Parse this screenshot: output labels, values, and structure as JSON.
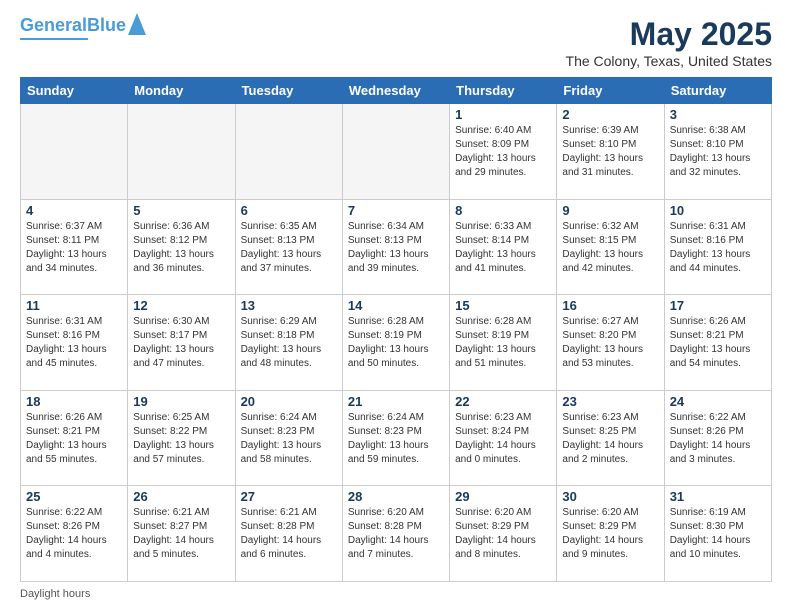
{
  "logo": {
    "line1": "General",
    "line2": "Blue"
  },
  "title": "May 2025",
  "subtitle": "The Colony, Texas, United States",
  "days_header": [
    "Sunday",
    "Monday",
    "Tuesday",
    "Wednesday",
    "Thursday",
    "Friday",
    "Saturday"
  ],
  "weeks": [
    [
      {
        "num": "",
        "info": ""
      },
      {
        "num": "",
        "info": ""
      },
      {
        "num": "",
        "info": ""
      },
      {
        "num": "",
        "info": ""
      },
      {
        "num": "1",
        "info": "Sunrise: 6:40 AM\nSunset: 8:09 PM\nDaylight: 13 hours and 29 minutes."
      },
      {
        "num": "2",
        "info": "Sunrise: 6:39 AM\nSunset: 8:10 PM\nDaylight: 13 hours and 31 minutes."
      },
      {
        "num": "3",
        "info": "Sunrise: 6:38 AM\nSunset: 8:10 PM\nDaylight: 13 hours and 32 minutes."
      }
    ],
    [
      {
        "num": "4",
        "info": "Sunrise: 6:37 AM\nSunset: 8:11 PM\nDaylight: 13 hours and 34 minutes."
      },
      {
        "num": "5",
        "info": "Sunrise: 6:36 AM\nSunset: 8:12 PM\nDaylight: 13 hours and 36 minutes."
      },
      {
        "num": "6",
        "info": "Sunrise: 6:35 AM\nSunset: 8:13 PM\nDaylight: 13 hours and 37 minutes."
      },
      {
        "num": "7",
        "info": "Sunrise: 6:34 AM\nSunset: 8:13 PM\nDaylight: 13 hours and 39 minutes."
      },
      {
        "num": "8",
        "info": "Sunrise: 6:33 AM\nSunset: 8:14 PM\nDaylight: 13 hours and 41 minutes."
      },
      {
        "num": "9",
        "info": "Sunrise: 6:32 AM\nSunset: 8:15 PM\nDaylight: 13 hours and 42 minutes."
      },
      {
        "num": "10",
        "info": "Sunrise: 6:31 AM\nSunset: 8:16 PM\nDaylight: 13 hours and 44 minutes."
      }
    ],
    [
      {
        "num": "11",
        "info": "Sunrise: 6:31 AM\nSunset: 8:16 PM\nDaylight: 13 hours and 45 minutes."
      },
      {
        "num": "12",
        "info": "Sunrise: 6:30 AM\nSunset: 8:17 PM\nDaylight: 13 hours and 47 minutes."
      },
      {
        "num": "13",
        "info": "Sunrise: 6:29 AM\nSunset: 8:18 PM\nDaylight: 13 hours and 48 minutes."
      },
      {
        "num": "14",
        "info": "Sunrise: 6:28 AM\nSunset: 8:19 PM\nDaylight: 13 hours and 50 minutes."
      },
      {
        "num": "15",
        "info": "Sunrise: 6:28 AM\nSunset: 8:19 PM\nDaylight: 13 hours and 51 minutes."
      },
      {
        "num": "16",
        "info": "Sunrise: 6:27 AM\nSunset: 8:20 PM\nDaylight: 13 hours and 53 minutes."
      },
      {
        "num": "17",
        "info": "Sunrise: 6:26 AM\nSunset: 8:21 PM\nDaylight: 13 hours and 54 minutes."
      }
    ],
    [
      {
        "num": "18",
        "info": "Sunrise: 6:26 AM\nSunset: 8:21 PM\nDaylight: 13 hours and 55 minutes."
      },
      {
        "num": "19",
        "info": "Sunrise: 6:25 AM\nSunset: 8:22 PM\nDaylight: 13 hours and 57 minutes."
      },
      {
        "num": "20",
        "info": "Sunrise: 6:24 AM\nSunset: 8:23 PM\nDaylight: 13 hours and 58 minutes."
      },
      {
        "num": "21",
        "info": "Sunrise: 6:24 AM\nSunset: 8:23 PM\nDaylight: 13 hours and 59 minutes."
      },
      {
        "num": "22",
        "info": "Sunrise: 6:23 AM\nSunset: 8:24 PM\nDaylight: 14 hours and 0 minutes."
      },
      {
        "num": "23",
        "info": "Sunrise: 6:23 AM\nSunset: 8:25 PM\nDaylight: 14 hours and 2 minutes."
      },
      {
        "num": "24",
        "info": "Sunrise: 6:22 AM\nSunset: 8:26 PM\nDaylight: 14 hours and 3 minutes."
      }
    ],
    [
      {
        "num": "25",
        "info": "Sunrise: 6:22 AM\nSunset: 8:26 PM\nDaylight: 14 hours and 4 minutes."
      },
      {
        "num": "26",
        "info": "Sunrise: 6:21 AM\nSunset: 8:27 PM\nDaylight: 14 hours and 5 minutes."
      },
      {
        "num": "27",
        "info": "Sunrise: 6:21 AM\nSunset: 8:28 PM\nDaylight: 14 hours and 6 minutes."
      },
      {
        "num": "28",
        "info": "Sunrise: 6:20 AM\nSunset: 8:28 PM\nDaylight: 14 hours and 7 minutes."
      },
      {
        "num": "29",
        "info": "Sunrise: 6:20 AM\nSunset: 8:29 PM\nDaylight: 14 hours and 8 minutes."
      },
      {
        "num": "30",
        "info": "Sunrise: 6:20 AM\nSunset: 8:29 PM\nDaylight: 14 hours and 9 minutes."
      },
      {
        "num": "31",
        "info": "Sunrise: 6:19 AM\nSunset: 8:30 PM\nDaylight: 14 hours and 10 minutes."
      }
    ]
  ],
  "footer": "Daylight hours"
}
